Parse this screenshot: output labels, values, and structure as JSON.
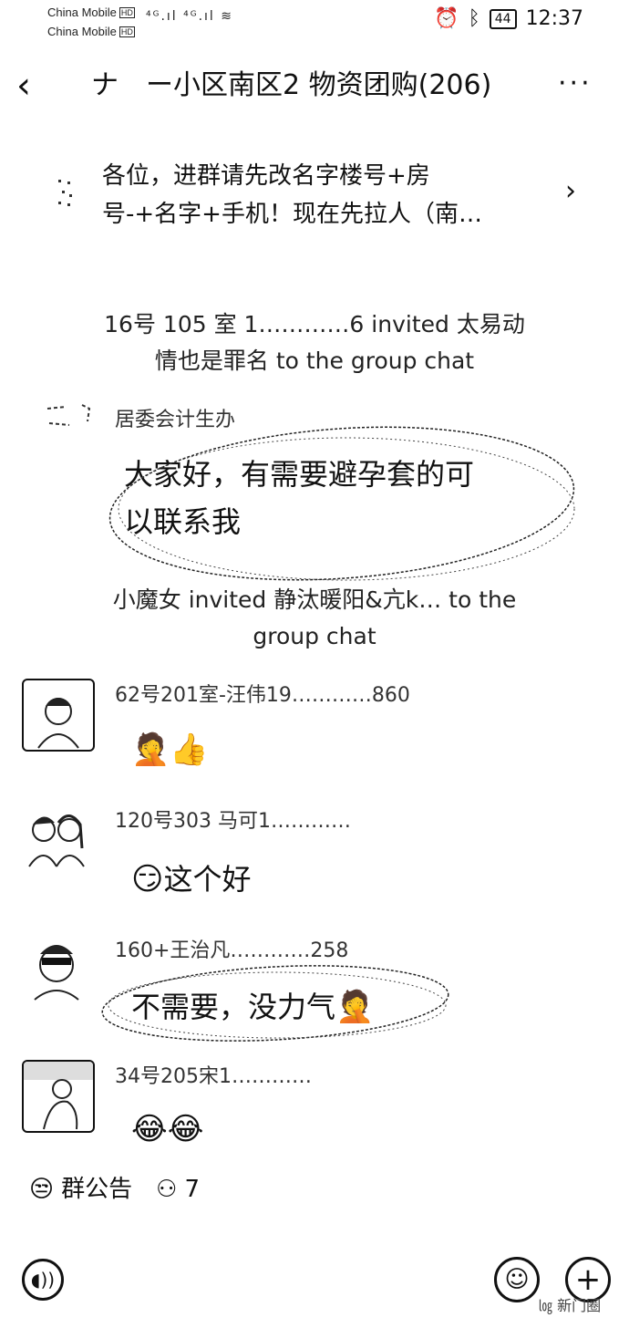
{
  "status_bar": {
    "carrier_1": "China Mobile",
    "carrier_2": "China Mobile",
    "hd": "HD",
    "signal": "⁴ᴳ.ıl ⁴ᴳ.ıl ≋",
    "battery": "44",
    "time": "12:37"
  },
  "header": {
    "back_label": "‹",
    "title": "ナ　ー小区南区2 物资团购(206)",
    "more_label": "···"
  },
  "notice": {
    "line1": "各位，进群请先改名字楼号+房",
    "line2": "号-+名字+手机！现在先拉人（南…",
    "chevron": "›"
  },
  "messages": [
    {
      "type": "system",
      "line1": "16号 105 室 1…………6 invited 太易动",
      "line2": "情也是罪名 to the group chat"
    },
    {
      "type": "chat",
      "sender": "居委会计生办",
      "line1": "大家好，有需要避孕套的可",
      "line2": "以联系我"
    },
    {
      "type": "system",
      "line1": "小魔女 invited 静汰暖阳&亢k… to the",
      "line2": "group chat"
    },
    {
      "type": "chat",
      "sender": "62号201室-汪伟19…………860",
      "emoji": "🤦👍"
    },
    {
      "type": "chat",
      "sender": "120号303 马可1…………",
      "emoji": "😏",
      "text": "这个好"
    },
    {
      "type": "chat",
      "sender": "160+王治凡…………258",
      "text": "不需要，没力气",
      "emoji": "🤦"
    },
    {
      "type": "chat",
      "sender": "34号205宋1…………",
      "emoji": "😂😂"
    }
  ],
  "footer": {
    "announcement_icon": "😒",
    "announcement_label": "群公告",
    "member_icon": "⚇",
    "member_count": "7",
    "watermark": "㏒ 新门圈"
  },
  "input_bar": {
    "voice_icon": "◖))",
    "emoji_icon": "☺",
    "plus_icon": "+"
  }
}
